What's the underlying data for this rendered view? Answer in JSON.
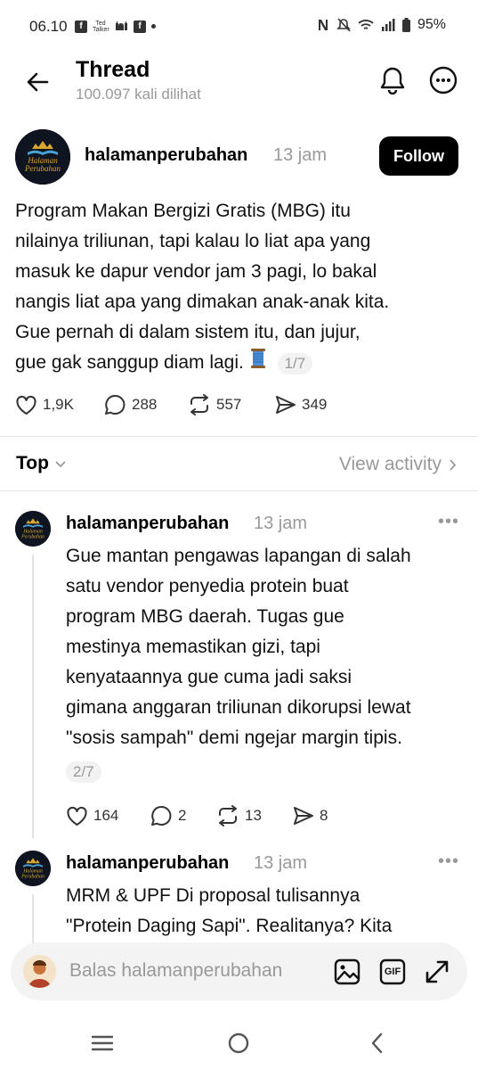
{
  "status": {
    "time": "06.10",
    "notif_text": "Ted Talker",
    "battery": "95%"
  },
  "header": {
    "title": "Thread",
    "views": "100.097 kali dilihat"
  },
  "avatar_logo": {
    "line1": "Halaman",
    "line2": "Perubahan"
  },
  "main_post": {
    "author": "halamanperubahan",
    "time": "13 jam",
    "follow_label": "Follow",
    "lines": [
      "Program Makan Bergizi Gratis (MBG) itu",
      "nilainya triliunan, tapi kalau lo liat apa yang",
      "masuk ke dapur vendor jam 3 pagi, lo bakal",
      "nangis liat apa yang dimakan anak-anak kita.",
      "Gue pernah di dalam sistem itu, dan jujur,",
      "gue gak sanggup diam lagi."
    ],
    "page": "1/7",
    "likes": "1,9K",
    "replies": "288",
    "reposts": "557",
    "shares": "349"
  },
  "sort": {
    "label": "Top",
    "view_activity": "View activity"
  },
  "replies": [
    {
      "author": "halamanperubahan",
      "time": "13 jam",
      "lines": [
        "Gue mantan pengawas lapangan di salah",
        "satu vendor penyedia protein buat",
        "program MBG daerah. Tugas gue",
        "mestinya memastikan gizi, tapi",
        "kenyataannya gue cuma jadi saksi",
        "gimana anggaran triliunan dikorupsi lewat",
        "\"sosis sampah\" demi ngejar margin tipis."
      ],
      "page": "2/7",
      "likes": "164",
      "replies": "2",
      "reposts": "13",
      "shares": "8"
    },
    {
      "author": "halamanperubahan",
      "time": "13 jam",
      "lines": [
        "MRM & UPF Di proposal tulisannya",
        "\"Protein Daging Sapi\". Realitanya? Kita"
      ]
    }
  ],
  "reply_bar": {
    "placeholder": "Balas halamanperubahan",
    "gif_label": "GIF"
  },
  "colors": {
    "accent": "#000000",
    "muted": "#999999",
    "logo_bg": "#0e1420",
    "logo_gold": "#d9a630",
    "logo_blue": "#4aa3d8"
  }
}
